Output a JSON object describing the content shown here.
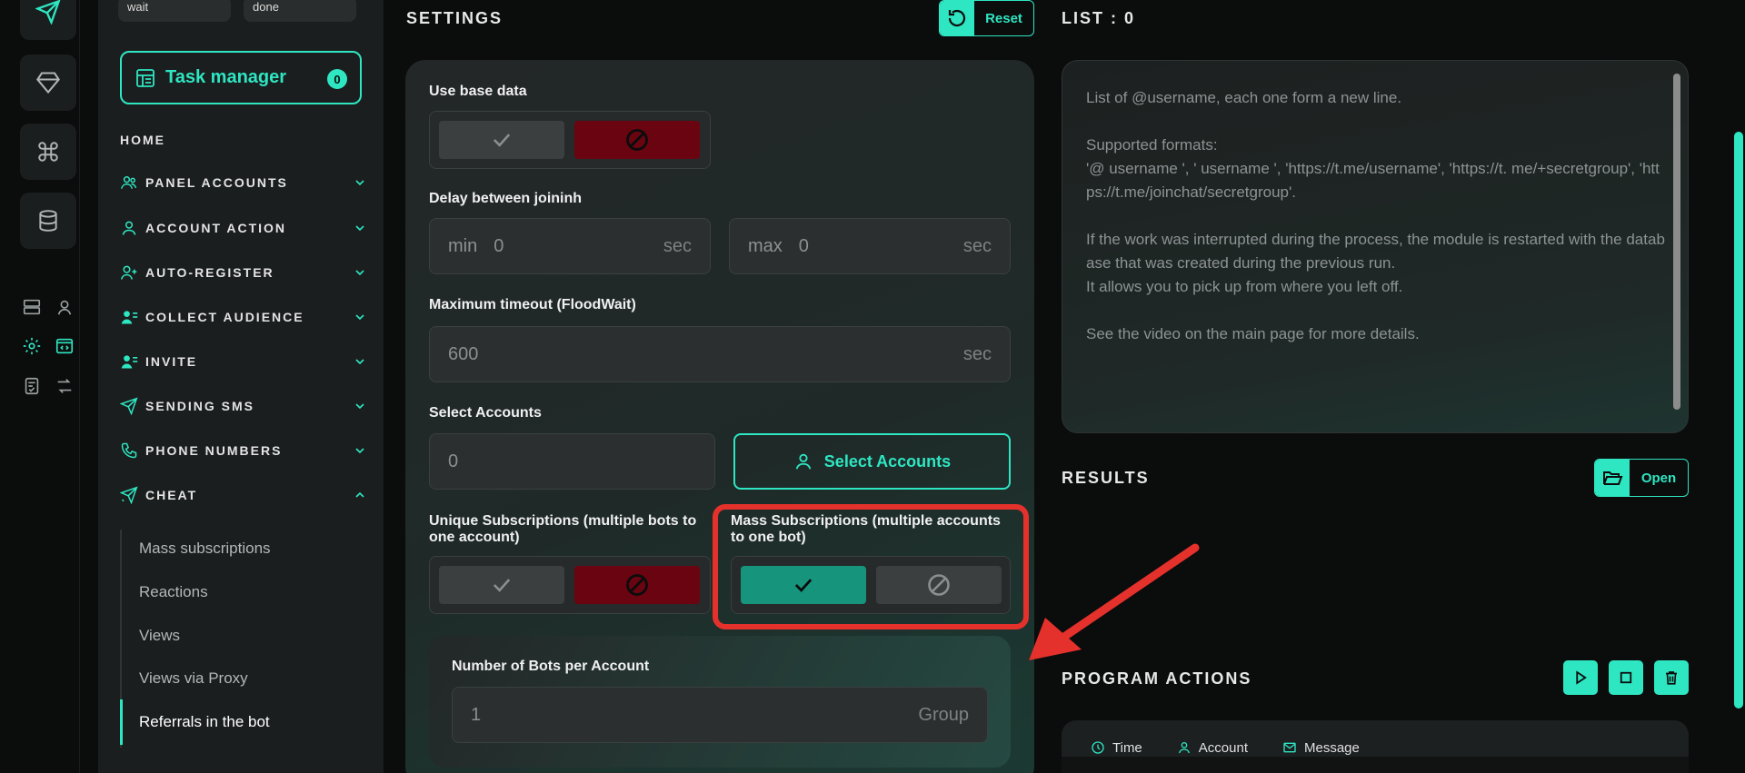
{
  "sidebar": {
    "chips": [
      "wait",
      "done"
    ],
    "task_manager": {
      "label": "Task manager",
      "count": "0"
    },
    "home": "HOME",
    "items": [
      {
        "label": "PANEL ACCOUNTS",
        "icon": "users-icon"
      },
      {
        "label": "ACCOUNT ACTION",
        "icon": "user-icon"
      },
      {
        "label": "AUTO-REGISTER",
        "icon": "user-plus-icon"
      },
      {
        "label": "COLLECT AUDIENCE",
        "icon": "user-list-icon"
      },
      {
        "label": "INVITE",
        "icon": "user-list-icon"
      },
      {
        "label": "SENDING SMS",
        "icon": "send-icon"
      },
      {
        "label": "PHONE NUMBERS",
        "icon": "phone-icon"
      },
      {
        "label": "CHEAT",
        "icon": "send-magic-icon"
      }
    ],
    "sub_items": [
      "Mass subscriptions",
      "Reactions",
      "Views",
      "Views via Proxy",
      "Referrals in the bot"
    ]
  },
  "settings": {
    "title": "SETTINGS",
    "reset_label": "Reset",
    "use_base_data": "Use base data",
    "delay_label": "Delay between joininh",
    "delay_min": {
      "prefix": "min",
      "value": "0",
      "suffix": "sec"
    },
    "delay_max": {
      "prefix": "max",
      "value": "0",
      "suffix": "sec"
    },
    "timeout_label": "Maximum timeout (FloodWait)",
    "timeout": {
      "value": "600",
      "suffix": "sec"
    },
    "select_accounts_label": "Select Accounts",
    "select_accounts_value": "0",
    "select_accounts_button": "Select Accounts",
    "unique_label": "Unique Subscriptions (multiple bots to one account)",
    "mass_label": "Mass Subscriptions (multiple accounts to one bot)",
    "bots_label": "Number of Bots per Account",
    "bots": {
      "value": "1",
      "suffix": "Group"
    }
  },
  "list": {
    "title": "LIST : 0",
    "placeholder": "List of @username, each one form a new line.\n\nSupported formats:\n'@ username ', ' username ', 'https://t.me/username', 'https://t. me/+secretgroup', 'https://t.me/joinchat/secretgroup'.\n\nIf the work was interrupted during the process, the module is restarted with the database that was created during the previous run.\nIt allows you to pick up from where you left off.\n\nSee the video on the main page for more details."
  },
  "results": {
    "title": "RESULTS",
    "open_label": "Open"
  },
  "actions": {
    "title": "PROGRAM ACTIONS",
    "columns": [
      "Time",
      "Account",
      "Message"
    ]
  },
  "colors": {
    "accent": "#2ee6c2",
    "danger": "#6a0410",
    "active": "#17947c",
    "highlight": "#e5312c"
  }
}
